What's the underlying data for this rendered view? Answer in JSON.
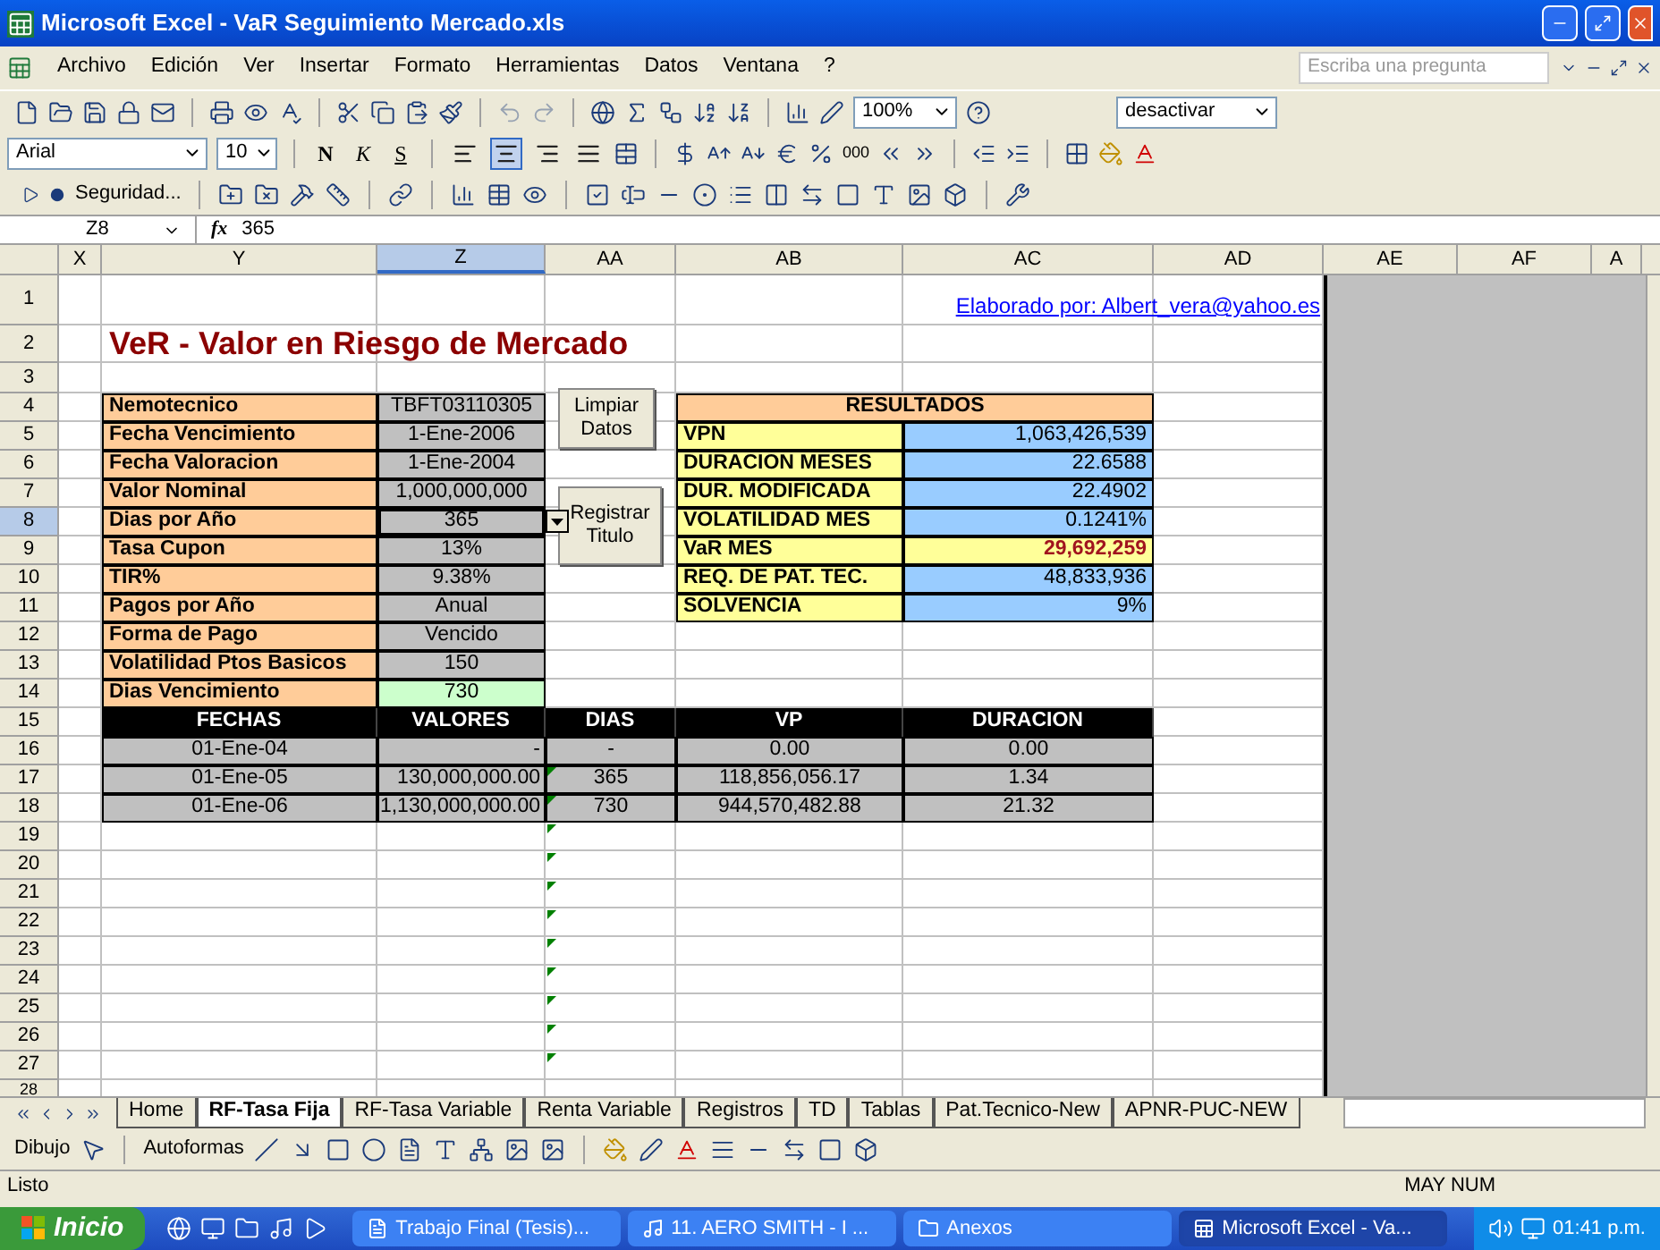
{
  "window": {
    "title": "Microsoft Excel - VaR Seguimiento Mercado.xls"
  },
  "menu": [
    "Archivo",
    "Edición",
    "Ver",
    "Insertar",
    "Formato",
    "Herramientas",
    "Datos",
    "Ventana",
    "?"
  ],
  "help_search": {
    "placeholder": "Escriba una pregunta"
  },
  "standard_toolbar": {
    "zoom": "100%",
    "combo": "desactivar"
  },
  "format_toolbar": {
    "font": "Arial",
    "size": "10",
    "style_buttons": [
      {
        "label": "N",
        "kind": "bold"
      },
      {
        "label": "K",
        "kind": "italic"
      },
      {
        "label": "S",
        "kind": "underline"
      }
    ],
    "align_buttons": [
      {
        "kind": "left",
        "selected": false
      },
      {
        "kind": "center",
        "selected": true
      },
      {
        "kind": "right",
        "selected": false
      },
      {
        "kind": "justify",
        "selected": false
      }
    ],
    "thousands": "000"
  },
  "forms_toolbar": {
    "label": "Seguridad..."
  },
  "formula_bar": {
    "cell": "Z8",
    "function_label": "fx",
    "formula": "365"
  },
  "columns": [
    {
      "label": "X",
      "selected": false
    },
    {
      "label": "Y",
      "selected": false
    },
    {
      "label": "Z",
      "selected": true
    },
    {
      "label": "AA",
      "selected": false
    },
    {
      "label": "AB",
      "selected": false
    },
    {
      "label": "AC",
      "selected": false
    },
    {
      "label": "AD",
      "selected": false
    },
    {
      "label": "AE",
      "selected": false
    },
    {
      "label": "AF",
      "selected": false
    },
    {
      "label": "A",
      "selected": false
    }
  ],
  "rows": [
    {
      "label": "1",
      "selected": false,
      "flag": false
    },
    {
      "label": "2",
      "selected": false,
      "flag": false
    },
    {
      "label": "3",
      "selected": false,
      "flag": false
    },
    {
      "label": "4",
      "selected": false,
      "flag": false
    },
    {
      "label": "5",
      "selected": false,
      "flag": false
    },
    {
      "label": "6",
      "selected": false,
      "flag": false
    },
    {
      "label": "7",
      "selected": false,
      "flag": false
    },
    {
      "label": "8",
      "selected": true,
      "flag": false
    },
    {
      "label": "9",
      "selected": false,
      "flag": false
    },
    {
      "label": "10",
      "selected": false,
      "flag": false
    },
    {
      "label": "11",
      "selected": false,
      "flag": false
    },
    {
      "label": "12",
      "selected": false,
      "flag": false
    },
    {
      "label": "13",
      "selected": false,
      "flag": false
    },
    {
      "label": "14",
      "selected": false,
      "flag": false
    },
    {
      "label": "15",
      "selected": false,
      "flag": false
    },
    {
      "label": "16",
      "selected": false,
      "flag": false
    },
    {
      "label": "17",
      "selected": false,
      "flag": true
    },
    {
      "label": "18",
      "selected": false,
      "flag": true
    },
    {
      "label": "19",
      "selected": false,
      "flag": true
    },
    {
      "label": "20",
      "selected": false,
      "flag": true
    },
    {
      "label": "21",
      "selected": false,
      "flag": true
    },
    {
      "label": "22",
      "selected": false,
      "flag": true
    },
    {
      "label": "23",
      "selected": false,
      "flag": true
    },
    {
      "label": "24",
      "selected": false,
      "flag": true
    },
    {
      "label": "25",
      "selected": false,
      "flag": true
    },
    {
      "label": "26",
      "selected": false,
      "flag": true
    },
    {
      "label": "27",
      "selected": false,
      "flag": true
    },
    {
      "label": "28",
      "selected": false,
      "flag": false
    }
  ],
  "sheet": {
    "link": "Elaborado por: Albert_vera@yahoo.es",
    "title": "VeR - Valor en Riesgo de Mercado",
    "parameters": [
      {
        "label": "Nemotecnico",
        "value": "TBFT03110305",
        "kind": "input",
        "selected": false
      },
      {
        "label": "Fecha Vencimiento",
        "value": "1-Ene-2006",
        "kind": "input",
        "selected": false
      },
      {
        "label": "Fecha Valoracion",
        "value": "1-Ene-2004",
        "kind": "input",
        "selected": false
      },
      {
        "label": "Valor Nominal",
        "value": "1,000,000,000",
        "kind": "input",
        "selected": false
      },
      {
        "label": "Dias por Año",
        "value": "365",
        "kind": "input",
        "selected": true
      },
      {
        "label": "Tasa Cupon",
        "value": "13%",
        "kind": "input",
        "selected": false
      },
      {
        "label": "TIR%",
        "value": "9.38%",
        "kind": "input",
        "selected": false
      },
      {
        "label": "Pagos por Año",
        "value": "Anual",
        "kind": "input",
        "selected": false
      },
      {
        "label": "Forma de Pago",
        "value": "Vencido",
        "kind": "input",
        "selected": false
      },
      {
        "label": "Volatilidad Ptos Basicos",
        "value": "150",
        "kind": "input",
        "selected": false
      },
      {
        "label": "Dias Vencimiento",
        "value": "730",
        "kind": "computed",
        "selected": false
      }
    ],
    "actions": [
      "Limpiar Datos",
      "Registrar Titulo"
    ],
    "results": {
      "title": "RESULTADOS",
      "rows": [
        {
          "label": "VPN",
          "value": "1,063,426,539",
          "highlight": false
        },
        {
          "label": "DURACION MESES",
          "value": "22.6588",
          "highlight": false
        },
        {
          "label": "DUR. MODIFICADA",
          "value": "22.4902",
          "highlight": false
        },
        {
          "label": "VOLATILIDAD MES",
          "value": "0.1241%",
          "highlight": false
        },
        {
          "label": "VaR MES",
          "value": "29,692,259",
          "highlight": true
        },
        {
          "label": "REQ. DE PAT. TEC.",
          "value": "48,833,936",
          "highlight": false
        },
        {
          "label": "SOLVENCIA",
          "value": "9%",
          "highlight": false
        }
      ]
    },
    "flows": {
      "columns": [
        "FECHAS",
        "VALORES",
        "DIAS",
        "VP",
        "DURACION"
      ],
      "rows": [
        [
          "01-Ene-04",
          "-",
          "-",
          "0.00",
          "0.00"
        ],
        [
          "01-Ene-05",
          "130,000,000.00",
          "365",
          "118,856,056.17",
          "1.34"
        ],
        [
          "01-Ene-06",
          "1,130,000,000.00",
          "730",
          "944,570,482.88",
          "21.32"
        ]
      ]
    }
  },
  "sheet_tabs": [
    {
      "label": "Home",
      "selected": false
    },
    {
      "label": "RF-Tasa Fija",
      "selected": true
    },
    {
      "label": "RF-Tasa Variable",
      "selected": false
    },
    {
      "label": "Renta Variable",
      "selected": false
    },
    {
      "label": "Registros",
      "selected": false
    },
    {
      "label": "TD",
      "selected": false
    },
    {
      "label": "Tablas",
      "selected": false
    },
    {
      "label": "Pat.Tecnico-New",
      "selected": false
    },
    {
      "label": "APNR-PUC-NEW",
      "selected": false
    }
  ],
  "drawing_toolbar": {
    "draw": "Dibujo",
    "autoshapes": "Autoformas"
  },
  "status_bar": {
    "left": "Listo",
    "right": "MAY NUM"
  },
  "taskbar": {
    "start": "Inicio",
    "tasks": [
      {
        "label": "Trabajo Final (Tesis)...",
        "kind": "document",
        "selected": false
      },
      {
        "label": "11. AERO SMITH - I ...",
        "kind": "media",
        "selected": false
      },
      {
        "label": "Anexos",
        "kind": "folder",
        "selected": false
      },
      {
        "label": "Microsoft Excel - Va...",
        "kind": "sheet",
        "selected": true
      }
    ],
    "clock": "01:41 p.m."
  }
}
